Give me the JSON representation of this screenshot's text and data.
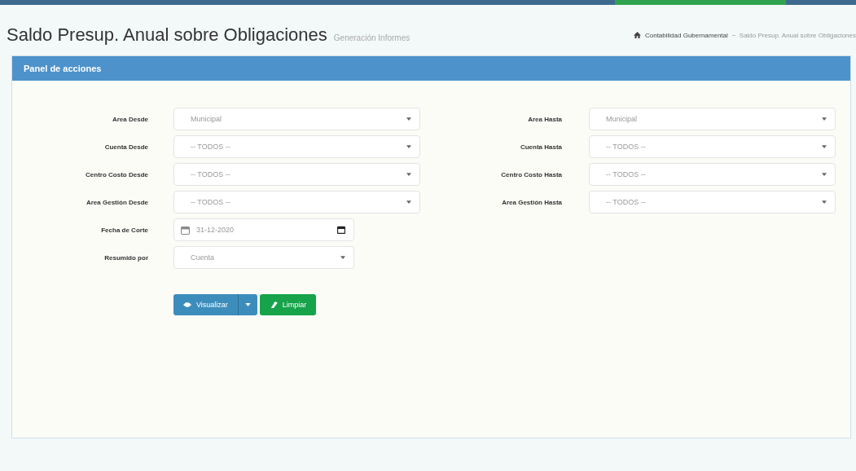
{
  "page_title": "Saldo Presup. Anual sobre Obligaciones",
  "page_subtitle": "Generación Informes",
  "breadcrumb": [
    "Contabilidad Gubernamental",
    "Saldo Presup. Anual sobre Obligaciones"
  ],
  "panel": {
    "title": "Panel de acciones"
  },
  "left_fields": [
    {
      "kind": "select",
      "label": "Area Desde",
      "value": "Municipal"
    },
    {
      "kind": "select",
      "label": "Cuenta Desde",
      "value": "-- TODOS --"
    },
    {
      "kind": "select",
      "label": "Centro Costo Desde",
      "value": "-- TODOS --"
    },
    {
      "kind": "select",
      "label": "Area Gestión Desde",
      "value": "-- TODOS --"
    },
    {
      "kind": "date",
      "label": "Fecha de Corte",
      "value": "31-12-2020"
    },
    {
      "kind": "short-select",
      "label": "Resumido por",
      "value": "Cuenta"
    }
  ],
  "right_fields": [
    {
      "kind": "select",
      "label": "Area Hasta",
      "value": "Municipal"
    },
    {
      "kind": "select",
      "label": "Cuenta Hasta",
      "value": "-- TODOS --"
    },
    {
      "kind": "select",
      "label": "Centro Costo Hasta",
      "value": "-- TODOS --"
    },
    {
      "kind": "select",
      "label": "Area Gestión Hasta",
      "value": "-- TODOS --"
    }
  ],
  "buttons": [
    {
      "kind": "primary",
      "label": "Visualizar"
    },
    {
      "kind": "success",
      "label": "Limpiar"
    }
  ]
}
